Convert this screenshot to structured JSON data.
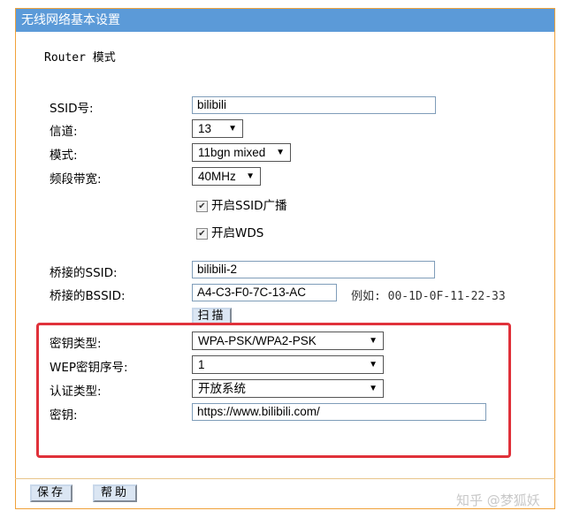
{
  "title": "无线网络基本设置",
  "mode_label": "Router 模式",
  "fields": {
    "ssid_label": "SSID号:",
    "ssid_value": "bilibili",
    "channel_label": "信道:",
    "channel_value": "13",
    "mode_label": "模式:",
    "mode_value": "11bgn mixed",
    "bandwidth_label": "频段带宽:",
    "bandwidth_value": "40MHz"
  },
  "checkboxes": {
    "ssid_broadcast": {
      "label": "开启SSID广播",
      "checked": true
    },
    "wds": {
      "label": "开启WDS",
      "checked": true
    }
  },
  "bridge": {
    "ssid_label": "桥接的SSID:",
    "ssid_value": "bilibili-2",
    "bssid_label": "桥接的BSSID:",
    "bssid_value": "A4-C3-F0-7C-13-AC",
    "bssid_hint": "例如: 00-1D-0F-11-22-33",
    "scan_button": "扫描"
  },
  "security": {
    "key_type_label": "密钥类型:",
    "key_type_value": "WPA-PSK/WPA2-PSK",
    "wep_index_label": "WEP密钥序号:",
    "wep_index_value": "1",
    "auth_type_label": "认证类型:",
    "auth_type_value": "开放系统",
    "key_label": "密钥:",
    "key_value": "https://www.bilibili.com/"
  },
  "footer": {
    "save_button": "保存",
    "help_button": "帮助"
  },
  "watermark": "知乎 @梦狐妖",
  "colors": {
    "titlebar": "#5b9ad8",
    "panel_border": "#f0a13a",
    "highlight_box": "#e0313a"
  }
}
